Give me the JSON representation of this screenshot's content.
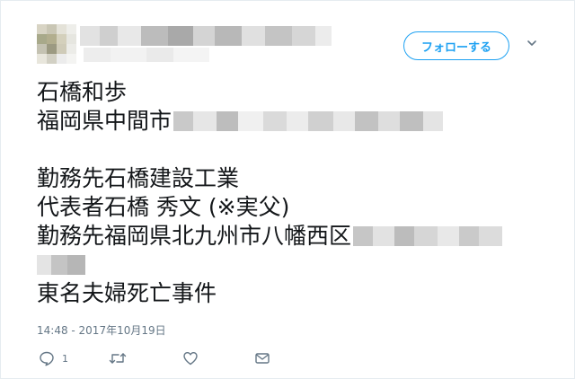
{
  "header": {
    "follow_label": "フォローする"
  },
  "tweet": {
    "lines": [
      "石橋和歩",
      "福岡県中間市",
      "",
      "勤務先石橋建設工業",
      "代表者石橋 秀文 (※実父)",
      "勤務先福岡県北九州市八幡西区",
      "",
      "東名夫婦死亡事件"
    ],
    "timestamp": "14:48 - 2017年10月19日"
  },
  "actions": {
    "reply_count": "1"
  },
  "colors": {
    "accent": "#1da1f2",
    "text": "#14171a",
    "muted": "#657786"
  },
  "icons": [
    "chevron-down-icon",
    "reply-icon",
    "retweet-icon",
    "like-icon",
    "message-icon"
  ]
}
